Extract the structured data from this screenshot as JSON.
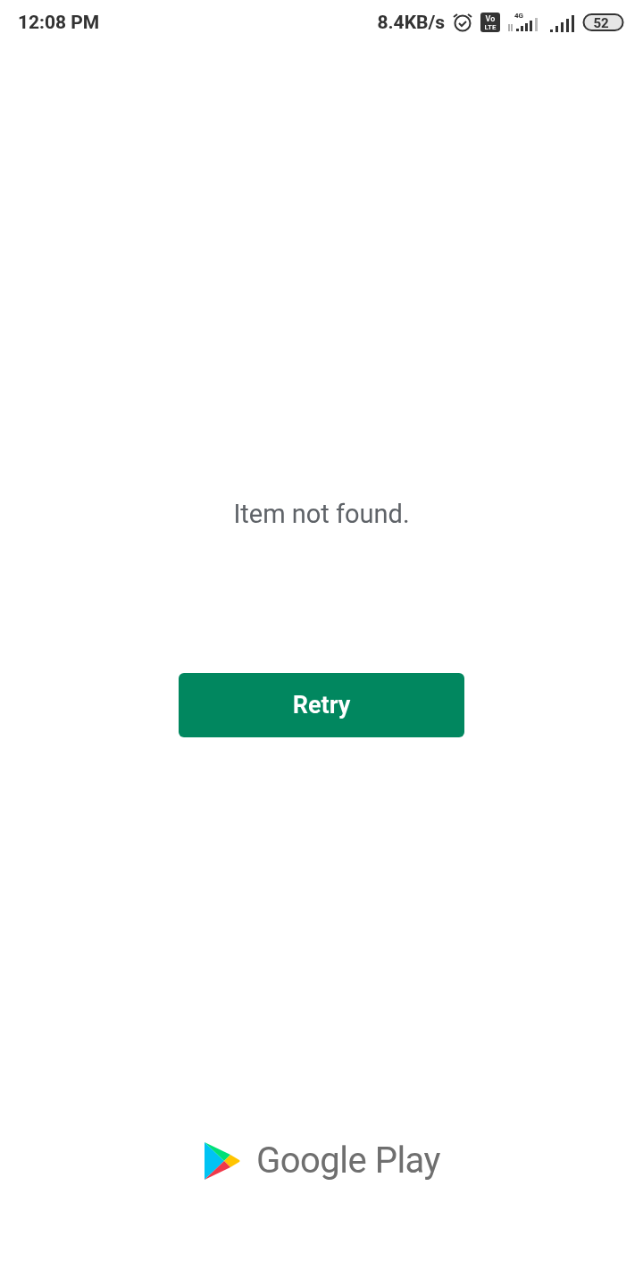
{
  "status_bar": {
    "time": "12:08 PM",
    "speed": "8.4KB/s",
    "volte": [
      "Vo",
      "LTE"
    ],
    "network": "4G",
    "battery": "52"
  },
  "message": "Item not found.",
  "button": "Retry",
  "logo": "Google Play"
}
